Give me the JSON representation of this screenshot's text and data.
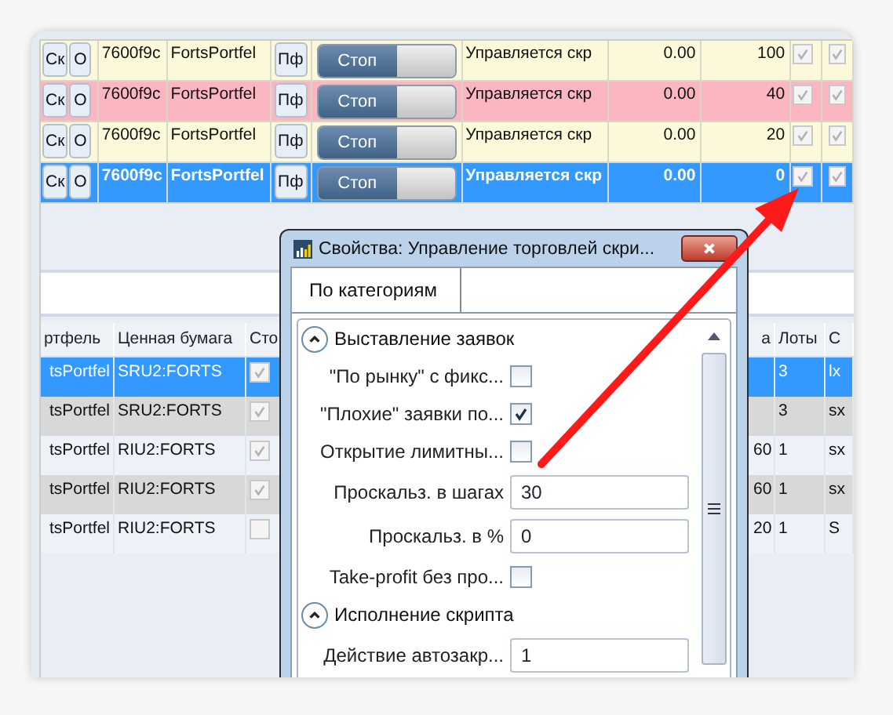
{
  "top_grid": {
    "rows": [
      {
        "buttons": [
          "Ск",
          "О"
        ],
        "code": "7600f9c",
        "portfolio": "FortsPortfel",
        "portfolio_button": "Пф",
        "toggle": "Стоп",
        "status": "Управляется скр",
        "value": "0.00",
        "volume": "100",
        "checked": true,
        "checked_2": true,
        "color": "#fbf9d9",
        "selected": false
      },
      {
        "buttons": [
          "Ск",
          "О"
        ],
        "code": "7600f9c",
        "portfolio": "FortsPortfel",
        "portfolio_button": "Пф",
        "toggle": "Стоп",
        "status": "Управляется скр",
        "value": "0.00",
        "volume": "40",
        "checked": true,
        "checked_2": true,
        "color": "#fbb6c1",
        "selected": false
      },
      {
        "buttons": [
          "Ск",
          "О"
        ],
        "code": "7600f9c",
        "portfolio": "FortsPortfel",
        "portfolio_button": "Пф",
        "toggle": "Стоп",
        "status": "Управляется скр",
        "value": "0.00",
        "volume": "20",
        "checked": true,
        "checked_2": true,
        "color": "#fbf9d9",
        "selected": false
      },
      {
        "buttons": [
          "Ск",
          "О"
        ],
        "code": "7600f9c",
        "portfolio": "FortsPortfel",
        "portfolio_button": "Пф",
        "toggle": "Стоп",
        "status": "Управляется скр",
        "value": "0.00",
        "volume": "0",
        "checked": true,
        "checked_2": true,
        "selected": true
      }
    ]
  },
  "lower_grid": {
    "columns": [
      "ртфель",
      "Ценная бумага",
      "Сто",
      "а",
      "Лоты",
      "С"
    ],
    "rows": [
      {
        "portfolio": "tsPortfel",
        "security": "SRU2:FORTS",
        "checked": true,
        "lots": "3",
        "column_6": "lx",
        "selected": true
      },
      {
        "portfolio": "tsPortfel",
        "security": "SRU2:FORTS",
        "checked": true,
        "lots": "3",
        "column_6": "sx",
        "selected": false
      },
      {
        "portfolio": "tsPortfel",
        "security": "RIU2:FORTS",
        "checked": true,
        "column_4": "60",
        "lots": "1",
        "column_6": "sx",
        "selected": false
      },
      {
        "portfolio": "tsPortfel",
        "security": "RIU2:FORTS",
        "checked": true,
        "column_4": "60",
        "lots": "1",
        "column_6": "sx",
        "selected": false
      },
      {
        "portfolio": "tsPortfel",
        "security": "RIU2:FORTS",
        "checked": false,
        "column_4": "20",
        "lots": "1",
        "column_6": "S",
        "selected": false
      }
    ]
  },
  "dialog": {
    "title": "Свойства: Управление торговлей скри...",
    "tabs": [
      {
        "label": "По категориям",
        "selected": true
      }
    ],
    "categories": [
      {
        "name": "Выставление заявок",
        "expanded": true,
        "properties": [
          {
            "kind": "checkbox",
            "label": "\"По рынку\" с фикс...",
            "checked": false
          },
          {
            "kind": "checkbox",
            "label": "\"Плохие\" заявки по...",
            "checked": true
          },
          {
            "kind": "checkbox",
            "label": "Открытие лимитны...",
            "checked": false
          },
          {
            "kind": "text",
            "label": "Проскальз. в шагах",
            "value": "30"
          },
          {
            "kind": "text",
            "label": "Проскальз. в %",
            "value": "0"
          },
          {
            "kind": "checkbox",
            "label": "Take-profit без про...",
            "checked": false
          }
        ]
      },
      {
        "name": "Исполнение скрипта",
        "expanded": true,
        "properties": [
          {
            "kind": "text",
            "label": "Действие автозакр...",
            "value": "1"
          }
        ]
      }
    ]
  }
}
